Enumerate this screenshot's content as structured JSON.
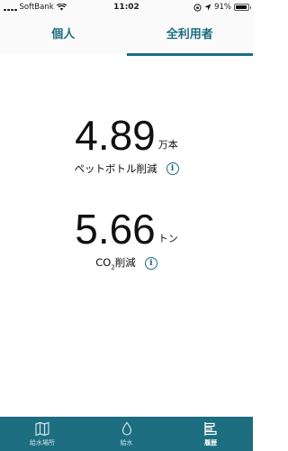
{
  "status_bar": {
    "carrier": "SoftBank",
    "time": "11:02",
    "battery": "91%",
    "battery_level": 0.91
  },
  "tabs": [
    {
      "label": "個人",
      "active": false
    },
    {
      "label": "全利用者",
      "active": true
    }
  ],
  "stats": {
    "bottles": {
      "value": "4.89",
      "unit": "万本",
      "label": "ペットボトル削減"
    },
    "co2": {
      "value": "5.66",
      "unit": "トン",
      "label_main": "CO",
      "label_sub": "2",
      "label_rest": "削減"
    }
  },
  "bottom_nav": [
    {
      "label": "給水場所",
      "icon": "map-icon",
      "active": false
    },
    {
      "label": "給水",
      "icon": "water-drop-icon",
      "active": false
    },
    {
      "label": "履歴",
      "icon": "history-icon",
      "active": true
    }
  ],
  "colors": {
    "accent": "#1c6e80",
    "text": "#111111",
    "background": "#ffffff"
  }
}
